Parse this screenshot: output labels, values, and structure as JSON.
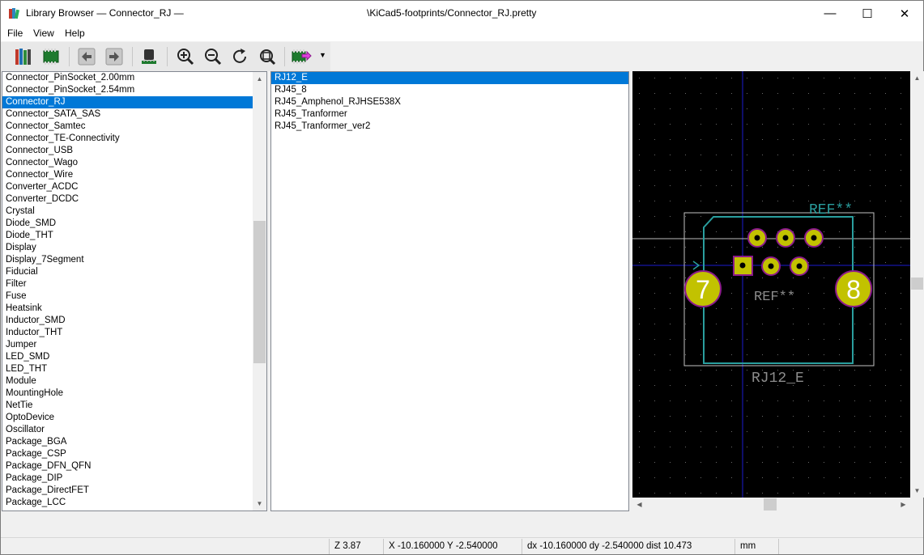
{
  "window": {
    "title": "Library Browser — Connector_RJ —",
    "path": "\\KiCad5-footprints/Connector_RJ.pretty",
    "minimize_glyph": "—",
    "maximize_glyph": "☐",
    "close_glyph": "✕"
  },
  "menu": {
    "file": "File",
    "view": "View",
    "help": "Help"
  },
  "toolbar": {
    "icons": [
      "library-icon",
      "footprint-icon",
      "back-icon",
      "forward-icon",
      "3d-viewer-icon",
      "zoom-in-icon",
      "zoom-out-icon",
      "redraw-icon",
      "zoom-fit-icon",
      "insert-footprint-icon"
    ],
    "dropdown_glyph": "▼"
  },
  "libraries": {
    "items": [
      "Connector_PinSocket_2.00mm",
      "Connector_PinSocket_2.54mm",
      "Connector_RJ",
      "Connector_SATA_SAS",
      "Connector_Samtec",
      "Connector_TE-Connectivity",
      "Connector_USB",
      "Connector_Wago",
      "Connector_Wire",
      "Converter_ACDC",
      "Converter_DCDC",
      "Crystal",
      "Diode_SMD",
      "Diode_THT",
      "Display",
      "Display_7Segment",
      "Fiducial",
      "Filter",
      "Fuse",
      "Heatsink",
      "Inductor_SMD",
      "Inductor_THT",
      "Jumper",
      "LED_SMD",
      "LED_THT",
      "Module",
      "MountingHole",
      "NetTie",
      "OptoDevice",
      "Oscillator",
      "Package_BGA",
      "Package_CSP",
      "Package_DFN_QFN",
      "Package_DIP",
      "Package_DirectFET",
      "Package_LCC"
    ],
    "selected": "Connector_RJ"
  },
  "footprints": {
    "items": [
      "RJ12_E",
      "RJ45_8",
      "RJ45_Amphenol_RJHSE538X",
      "RJ45_Tranformer",
      "RJ45_Tranformer_ver2"
    ],
    "selected": "RJ12_E"
  },
  "preview": {
    "ref_top": "REF**",
    "ref_center": "REF**",
    "value": "RJ12_E",
    "pad_left": "7",
    "pad_right": "8",
    "colors": {
      "background": "#000000",
      "courtyard": "#c2c2c2",
      "fab": "#2a9e9e",
      "pad": "#c2c200",
      "pad_outline": "#8b1a8b"
    }
  },
  "status": {
    "zoom": "Z 3.87",
    "xy": "X -10.160000  Y -2.540000",
    "delta": "dx -10.160000  dy -2.540000  dist 10.473",
    "units": "mm"
  }
}
